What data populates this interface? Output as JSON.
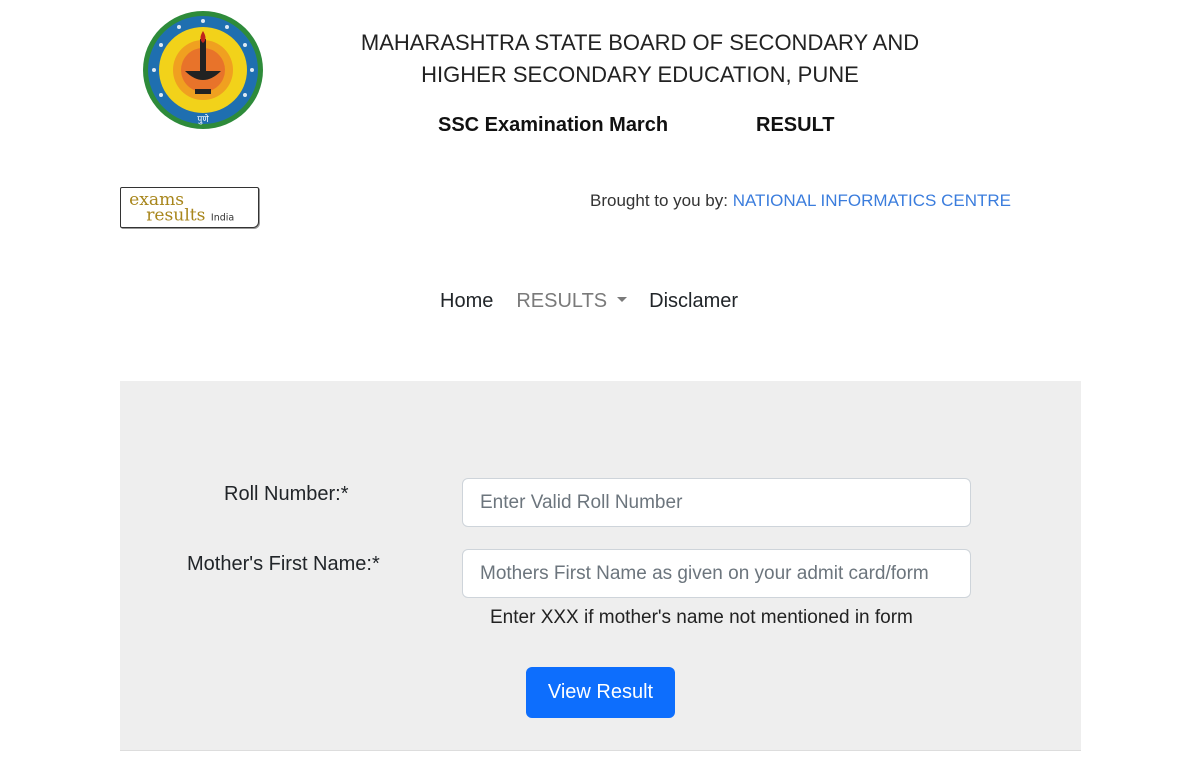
{
  "header": {
    "board_title_line1": "MAHARASHTRA STATE BOARD OF SECONDARY AND",
    "board_title_line2": "HIGHER SECONDARY EDUCATION, PUNE",
    "exam_name": "SSC Examination March",
    "exam_result": "RESULT",
    "seal_icon": "maharashtra-board-seal-icon",
    "seal_text_bottom": "पुणे",
    "brought_prefix": "Brought to you by: ",
    "brought_org": "NATIONAL INFORMATICS CENTRE",
    "brought_link_color": "#3b7ddd"
  },
  "exams_logo": {
    "word1": "exams",
    "word2": "results",
    "word3": "India",
    "color": "#a8861c"
  },
  "nav": {
    "home": "Home",
    "results": "RESULTS",
    "disclaimer": "Disclamer"
  },
  "form": {
    "roll_label": "Roll Number:*",
    "roll_value": "",
    "roll_placeholder": "Enter Valid Roll Number",
    "mother_label": "Mother's First Name:*",
    "mother_value": "",
    "mother_placeholder": "Mothers First Name as given on your admit card/form",
    "hint": "Enter XXX if mother's name not mentioned in form",
    "submit_label": "View Result",
    "panel_color": "#eeeeee",
    "button_color": "#0d6efd"
  }
}
